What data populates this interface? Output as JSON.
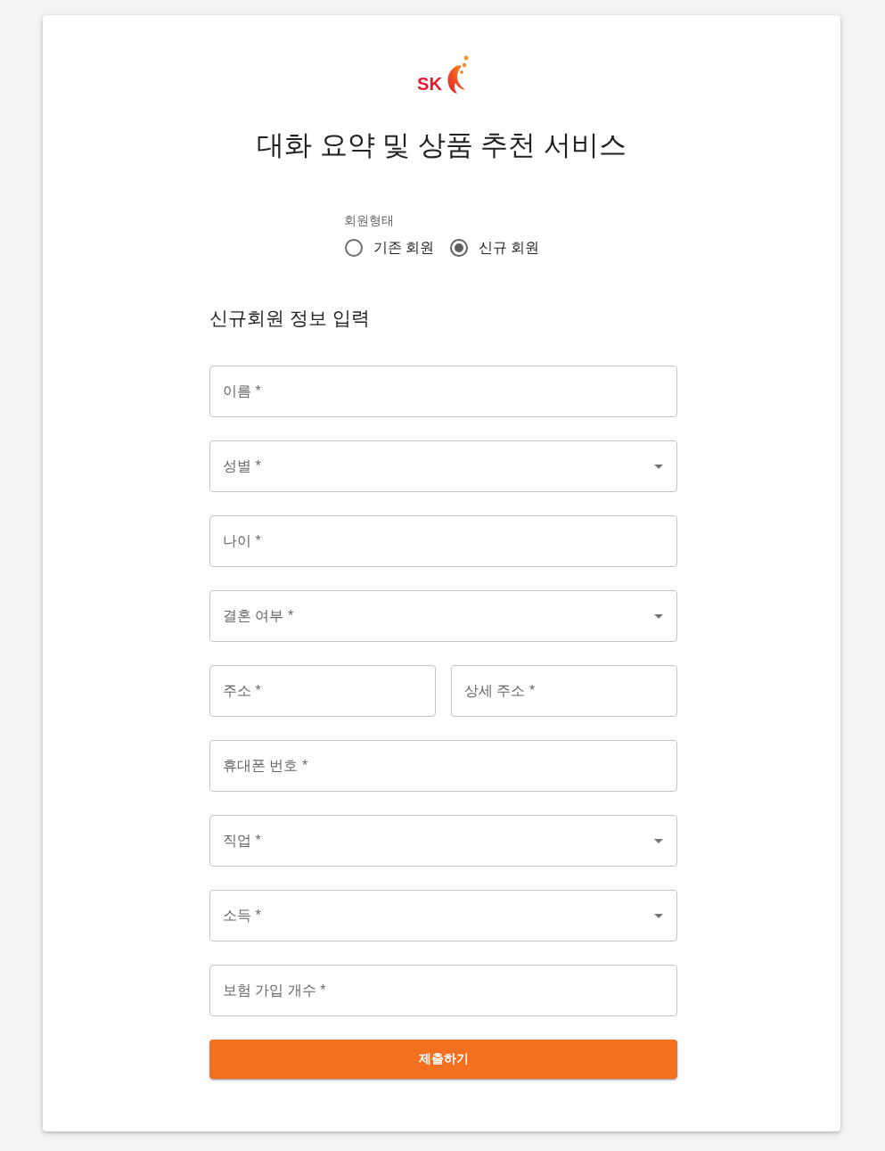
{
  "logo": {
    "text": "SK"
  },
  "title": "대화 요약 및 상품 추천 서비스",
  "member_type": {
    "label": "회원형태",
    "options": [
      {
        "label": "기존 회원",
        "selected": false
      },
      {
        "label": "신규 회원",
        "selected": true
      }
    ]
  },
  "section_title": "신규회원 정보 입력",
  "rows": [
    {
      "fields": [
        {
          "kind": "text",
          "placeholder": "이름 *"
        }
      ]
    },
    {
      "fields": [
        {
          "kind": "select",
          "placeholder": "성별 *"
        }
      ]
    },
    {
      "fields": [
        {
          "kind": "text",
          "placeholder": "나이 *"
        }
      ]
    },
    {
      "fields": [
        {
          "kind": "select",
          "placeholder": "결혼 여부 *"
        }
      ]
    },
    {
      "fields": [
        {
          "kind": "text",
          "placeholder": "주소 *"
        },
        {
          "kind": "text",
          "placeholder": "상세 주소 *"
        }
      ]
    },
    {
      "fields": [
        {
          "kind": "text",
          "placeholder": "휴대폰 번호 *"
        }
      ]
    },
    {
      "fields": [
        {
          "kind": "select",
          "placeholder": "직업 *"
        }
      ]
    },
    {
      "fields": [
        {
          "kind": "select",
          "placeholder": "소득 *"
        }
      ]
    },
    {
      "fields": [
        {
          "kind": "text",
          "placeholder": "보험 가입 개수 *"
        }
      ]
    }
  ],
  "submit_button": "제출하기"
}
